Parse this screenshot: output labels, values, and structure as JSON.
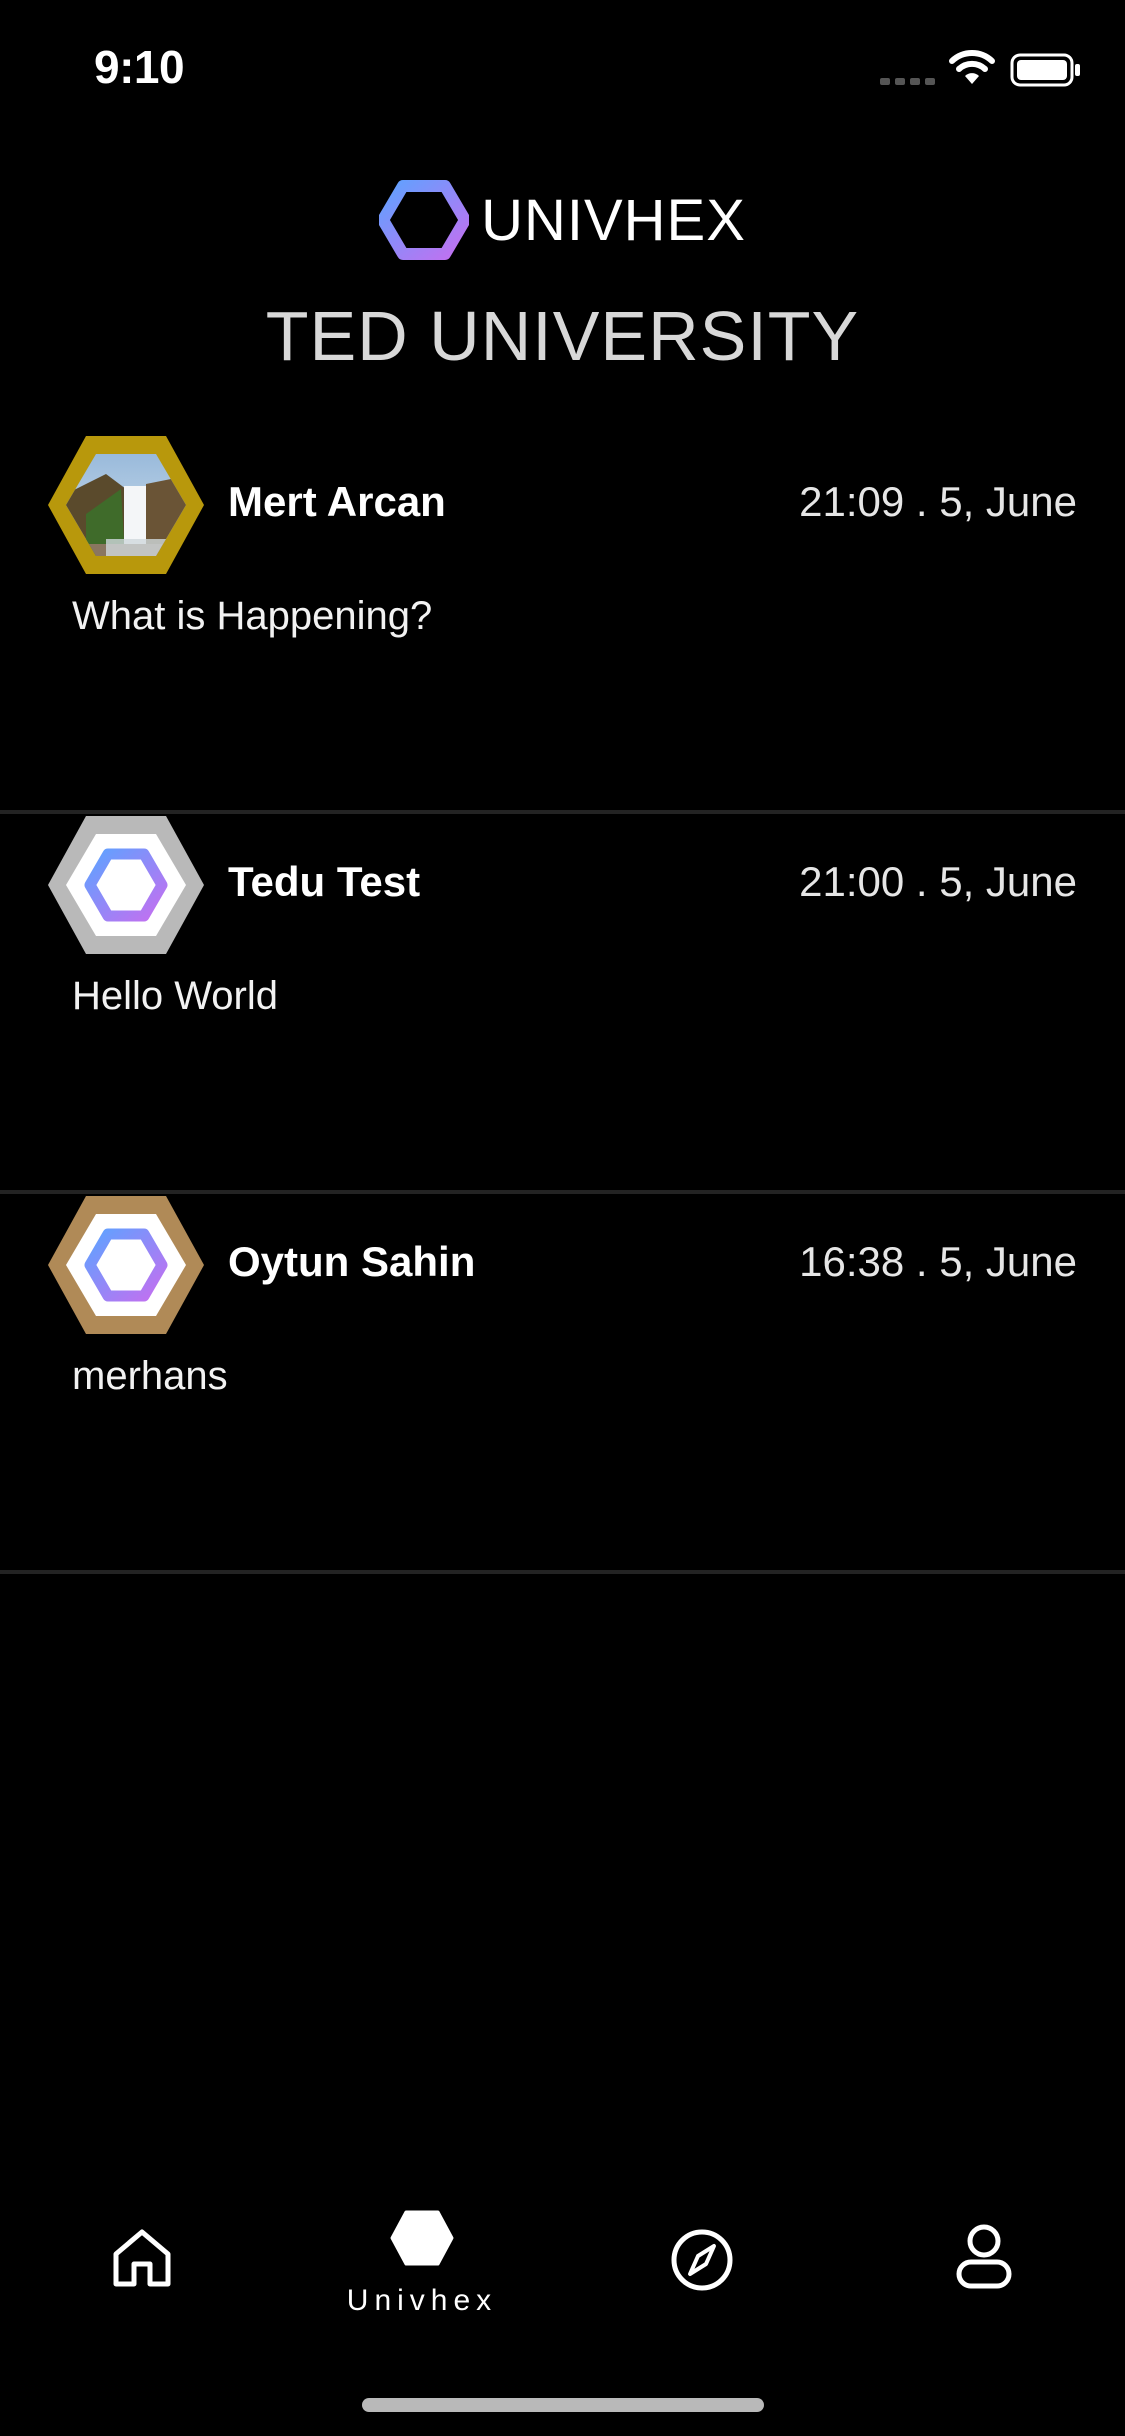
{
  "status_bar": {
    "time": "9:10"
  },
  "brand": {
    "name": "UNIVHEX"
  },
  "header": {
    "title": "TED UNIVERSITY"
  },
  "posts": [
    {
      "author": "Mert Arcan",
      "time": "21:09 . 5, June",
      "text": "What is Happening?",
      "avatar_frame_color": "#b8980c",
      "avatar_type": "photo-waterfall"
    },
    {
      "author": "Tedu Test",
      "time": "21:00 . 5, June",
      "text": "Hello World",
      "avatar_frame_color": "#b9b9b9",
      "avatar_type": "hex-logo"
    },
    {
      "author": "Oytun Sahin",
      "time": "16:38 . 5, June",
      "text": "merhans",
      "avatar_frame_color": "#b08a57",
      "avatar_type": "hex-logo"
    }
  ],
  "tab_bar": {
    "tabs": [
      {
        "icon": "home-icon",
        "label": ""
      },
      {
        "icon": "hexagon-icon",
        "label": "Univhex",
        "active": true
      },
      {
        "icon": "compass-icon",
        "label": ""
      },
      {
        "icon": "profile-icon",
        "label": ""
      }
    ]
  },
  "colors": {
    "background": "#000000",
    "divider": "#232323",
    "gradient_start": "#6aa0ff",
    "gradient_end": "#b678f0"
  }
}
